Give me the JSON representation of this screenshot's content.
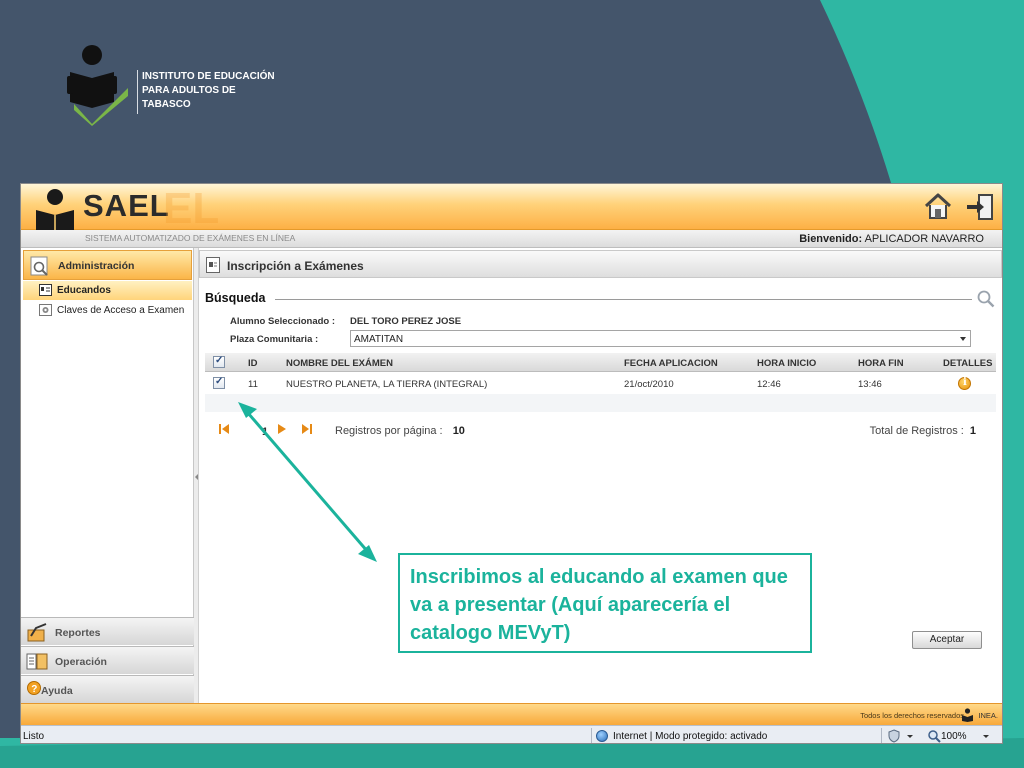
{
  "slide": {
    "institute_lines": [
      "INSTITUTO DE EDUCACIÓN",
      "PARA ADULTOS DE",
      "TABASCO"
    ]
  },
  "app": {
    "name": "SAEL",
    "name_ghost": "EL",
    "subtitle": "SISTEMA AUTOMATIZADO DE EXÁMENES EN LÍNEA",
    "welcome_label": "Bienvenido:",
    "welcome_user": "APLICADOR NAVARRO"
  },
  "sidebar": {
    "section": "Administración",
    "items": [
      {
        "label": "Educandos",
        "active": true
      },
      {
        "label": "Claves de Acceso a Examen",
        "active": false
      }
    ],
    "bottom": [
      {
        "label": "Reportes"
      },
      {
        "label": "Operación"
      },
      {
        "label": "Ayuda"
      }
    ]
  },
  "main": {
    "title": "Inscripción a Exámenes",
    "search_heading": "Búsqueda",
    "student_label": "Alumno Seleccionado :",
    "student_value": "DEL TORO PEREZ JOSE",
    "plaza_label": "Plaza Comunitaria :",
    "plaza_value": "AMATITAN",
    "table": {
      "headers": [
        "ID",
        "NOMBRE DEL EXÁMEN",
        "FECHA APLICACION",
        "HORA INICIO",
        "HORA FIN",
        "DETALLES"
      ],
      "rows": [
        {
          "id": "11",
          "name": "NUESTRO PLANETA, LA TIERRA (INTEGRAL)",
          "date": "21/oct/2010",
          "start": "12:46",
          "end": "13:46",
          "checked": true
        }
      ]
    },
    "pager": {
      "page": "1",
      "per_page_label": "Registros por página :",
      "per_page_value": "10",
      "total_label": "Total de Registros :",
      "total_value": "1"
    },
    "accept_label": "Aceptar"
  },
  "footer": {
    "rights": "Todos los derechos reservados",
    "brand": "INEA."
  },
  "statusbar": {
    "status": "Listo",
    "zone": "Internet | Modo protegido: activado",
    "zoom": "100%"
  },
  "annotation": {
    "text": "Inscribimos al educando al examen que va a presentar (Aquí aparecería el catalogo MEVyT)"
  },
  "colors": {
    "slide_bg": "#44556b",
    "teal": "#2fb7a3",
    "accent_orange": "#fbb548",
    "annotation": "#1bb39c"
  }
}
